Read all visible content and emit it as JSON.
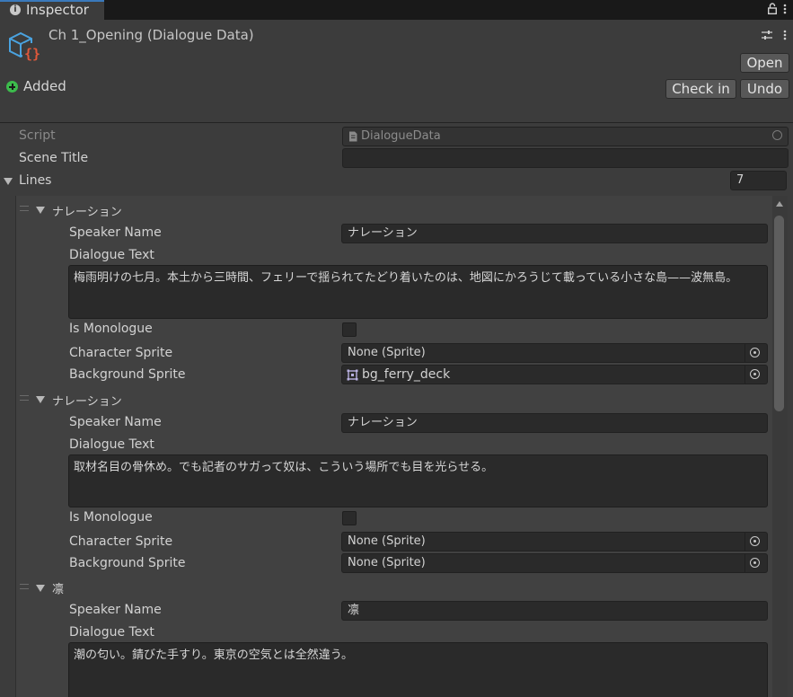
{
  "tab": {
    "title": "Inspector"
  },
  "header": {
    "asset_title": "Ch 1_Opening (Dialogue Data)",
    "open_label": "Open",
    "checkin_label": "Check in",
    "undo_label": "Undo",
    "added_label": "Added"
  },
  "properties": {
    "script_label": "Script",
    "script_value": "DialogueData",
    "scene_title_label": "Scene Title",
    "scene_title_value": "",
    "lines_label": "Lines",
    "lines_count": "7"
  },
  "field_labels": {
    "speaker_name": "Speaker Name",
    "dialogue_text": "Dialogue Text",
    "is_monologue": "Is Monologue",
    "character_sprite": "Character Sprite",
    "background_sprite": "Background Sprite"
  },
  "lines": [
    {
      "header": "ナレーション",
      "speaker_name": "ナレーション",
      "dialogue_text": "梅雨明けの七月。本土から三時間、フェリーで揺られてたどり着いたのは、地図にかろうじて載っている小さな島——波無島。",
      "is_monologue": false,
      "character_sprite": "None (Sprite)",
      "background_sprite": "bg_ferry_deck"
    },
    {
      "header": "ナレーション",
      "speaker_name": "ナレーション",
      "dialogue_text": "取材名目の骨休め。でも記者のサガって奴は、こういう場所でも目を光らせる。",
      "is_monologue": false,
      "character_sprite": "None (Sprite)",
      "background_sprite": "None (Sprite)"
    },
    {
      "header": "凛",
      "speaker_name": "凛",
      "dialogue_text": "潮の匂い。錆びた手すり。東京の空気とは全然違う。"
    }
  ]
}
